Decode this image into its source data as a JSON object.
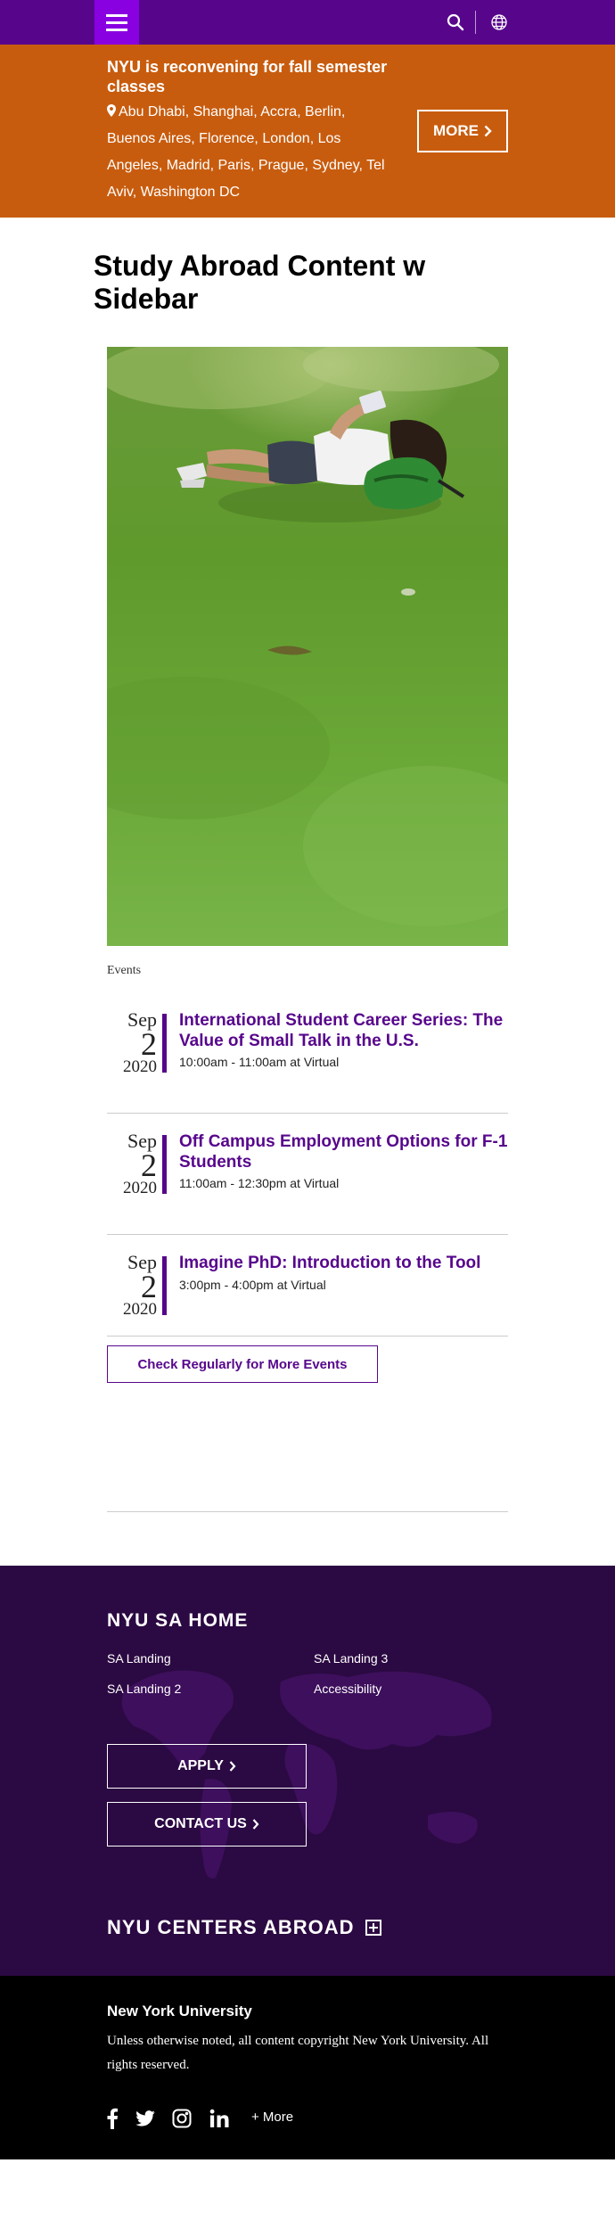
{
  "alert": {
    "title": "NYU is reconvening for fall semester classes",
    "locations": "Abu Dhabi, Shanghai, Accra, Berlin, Buenos Aires, Florence, London, Los Angeles, Madrid, Paris, Prague, Sydney, Tel Aviv, Washington DC",
    "more_label": "MORE"
  },
  "page": {
    "title": "Study Abroad Content w Sidebar",
    "events_heading": "Events"
  },
  "events": [
    {
      "month": "Sep",
      "day": "2",
      "year": "2020",
      "title": "International Student Career Series: The Value of Small Talk in the U.S.",
      "time": "10:00am - 11:00am at Virtual"
    },
    {
      "month": "Sep",
      "day": "2",
      "year": "2020",
      "title": "Off Campus Employment Options for F-1 Students",
      "time": "11:00am - 12:30pm at Virtual"
    },
    {
      "month": "Sep",
      "day": "2",
      "year": "2020",
      "title": "Imagine PhD: Introduction to the Tool",
      "time": "3:00pm - 4:00pm at Virtual"
    }
  ],
  "more_events_label": "Check Regularly for More Events",
  "footer": {
    "title": "NYU SA HOME",
    "links": [
      "SA Landing",
      "SA Landing 3",
      "SA Landing 2",
      "Accessibility"
    ],
    "apply_label": "APPLY",
    "contact_label": "CONTACT US",
    "centers_title": "NYU CENTERS ABROAD"
  },
  "bottom": {
    "title": "New York University",
    "copyright": "Unless otherwise noted, all content copyright New York University. All rights reserved.",
    "more_label": "+ More"
  },
  "colors": {
    "nyu_violet": "#57068c",
    "menu_violet": "#8900e1",
    "alert_orange": "#c85c0e",
    "footer_dark": "#2b0942"
  }
}
